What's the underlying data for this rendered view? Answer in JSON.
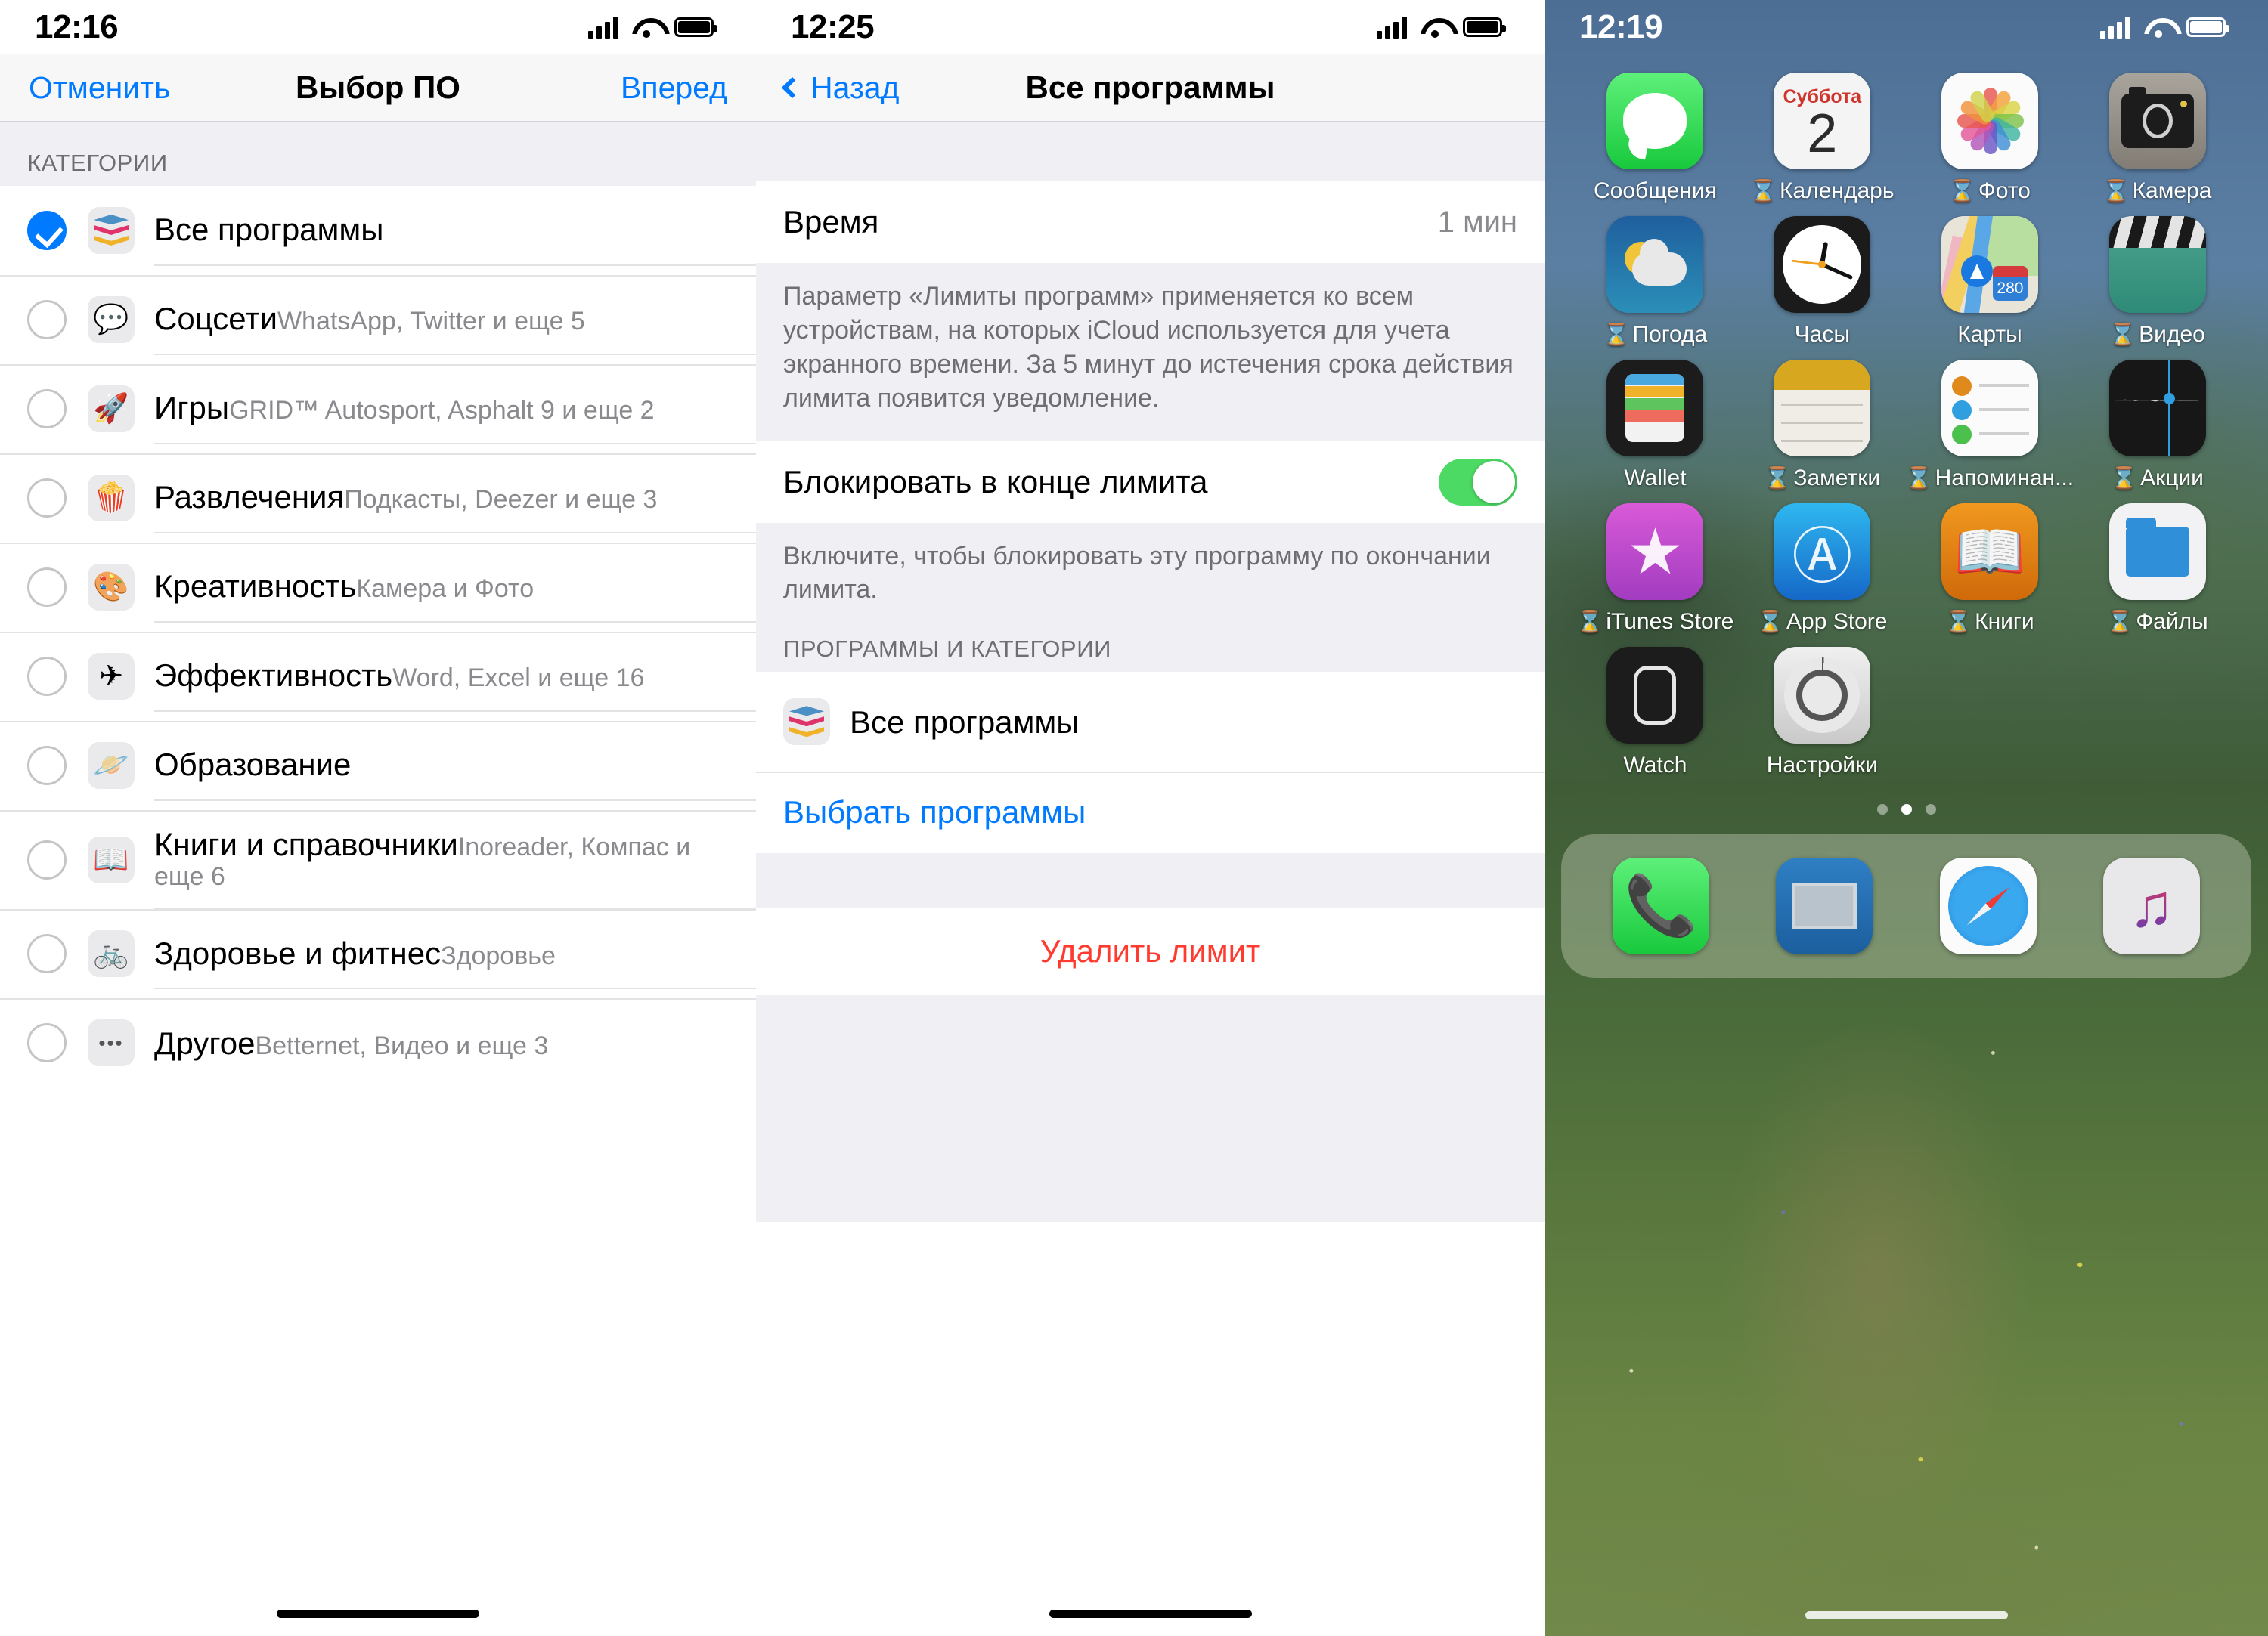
{
  "screen1": {
    "status": {
      "time": "12:16"
    },
    "nav": {
      "left": "Отменить",
      "title": "Выбор ПО",
      "right": "Вперед"
    },
    "section_header": "КАТЕГОРИИ",
    "categories": [
      {
        "title": "Все программы",
        "subtitle": "",
        "icon": "layers-icon",
        "selected": true
      },
      {
        "title": "Соцсети",
        "subtitle": "WhatsApp, Twitter и еще 5",
        "icon": "chat-heart-icon",
        "selected": false
      },
      {
        "title": "Игры",
        "subtitle": "GRID™ Autosport, Asphalt 9 и еще 2",
        "icon": "rocket-icon",
        "selected": false
      },
      {
        "title": "Развлечения",
        "subtitle": "Подкасты, Deezer и еще 3",
        "icon": "popcorn-icon",
        "selected": false
      },
      {
        "title": "Креативность",
        "subtitle": "Камера и Фото",
        "icon": "palette-icon",
        "selected": false
      },
      {
        "title": "Эффективность",
        "subtitle": "Word, Excel и еще 16",
        "icon": "paper-plane-icon",
        "selected": false
      },
      {
        "title": "Образование",
        "subtitle": "",
        "icon": "atom-icon",
        "selected": false
      },
      {
        "title": "Книги и справочники",
        "subtitle": "Inoreader, Компас и еще 6",
        "icon": "book-icon",
        "selected": false
      },
      {
        "title": "Здоровье и фитнес",
        "subtitle": "Здоровье",
        "icon": "bicycle-icon",
        "selected": false
      },
      {
        "title": "Другое",
        "subtitle": "Betternet, Видео и еще 3",
        "icon": "ellipsis-icon",
        "selected": false
      }
    ]
  },
  "screen2": {
    "status": {
      "time": "12:25"
    },
    "nav": {
      "left": "Назад",
      "title": "Все программы"
    },
    "time_row": {
      "label": "Время",
      "value": "1 мин"
    },
    "time_footnote": "Параметр «Лимиты программ» применяется ко всем устройствам, на которых iCloud используется для учета экранного времени. За 5 минут до истечения срока действия лимита появится уведомление.",
    "block_row": {
      "label": "Блокировать в конце лимита",
      "toggle_on": true
    },
    "block_footnote": "Включите, чтобы блокировать эту программу по окончании лимита.",
    "apps_section_header": "ПРОГРАММЫ И КАТЕГОРИИ",
    "app_row": {
      "title": "Все программы",
      "icon": "layers-icon"
    },
    "choose_link": "Выбрать программы",
    "delete_button": "Удалить лимит"
  },
  "screen3": {
    "status": {
      "time": "12:19"
    },
    "apps": [
      {
        "label": "Сообщения",
        "limited": false,
        "icon": "messages-icon"
      },
      {
        "label": "Календарь",
        "limited": true,
        "icon": "calendar-icon",
        "weekday": "Суббота",
        "day": "2"
      },
      {
        "label": "Фото",
        "limited": true,
        "icon": "photos-icon"
      },
      {
        "label": "Камера",
        "limited": true,
        "icon": "camera-icon"
      },
      {
        "label": "Погода",
        "limited": true,
        "icon": "weather-icon"
      },
      {
        "label": "Часы",
        "limited": false,
        "icon": "clock-icon"
      },
      {
        "label": "Карты",
        "limited": false,
        "icon": "maps-icon",
        "road_number": "280"
      },
      {
        "label": "Видео",
        "limited": true,
        "icon": "video-icon"
      },
      {
        "label": "Wallet",
        "limited": false,
        "icon": "wallet-icon"
      },
      {
        "label": "Заметки",
        "limited": true,
        "icon": "notes-icon"
      },
      {
        "label": "Напоминан...",
        "limited": true,
        "icon": "reminders-icon"
      },
      {
        "label": "Акции",
        "limited": true,
        "icon": "stocks-icon"
      },
      {
        "label": "iTunes Store",
        "limited": true,
        "icon": "itunes-store-icon"
      },
      {
        "label": "App Store",
        "limited": true,
        "icon": "app-store-icon"
      },
      {
        "label": "Книги",
        "limited": true,
        "icon": "books-icon"
      },
      {
        "label": "Файлы",
        "limited": true,
        "icon": "files-icon"
      },
      {
        "label": "Watch",
        "limited": false,
        "icon": "watch-icon"
      },
      {
        "label": "Настройки",
        "limited": false,
        "icon": "settings-icon"
      }
    ],
    "page_dots": {
      "count": 3,
      "active_index": 1
    },
    "dock": [
      {
        "name": "Телефон",
        "icon": "phone-icon"
      },
      {
        "name": "Почта",
        "icon": "mail-icon"
      },
      {
        "name": "Safari",
        "icon": "safari-icon"
      },
      {
        "name": "Музыка",
        "icon": "music-icon"
      }
    ]
  },
  "colors": {
    "accent_blue": "#007aff",
    "toggle_green": "#4cd964",
    "destructive_red": "#ff3b30",
    "group_bg": "#efeff4"
  }
}
